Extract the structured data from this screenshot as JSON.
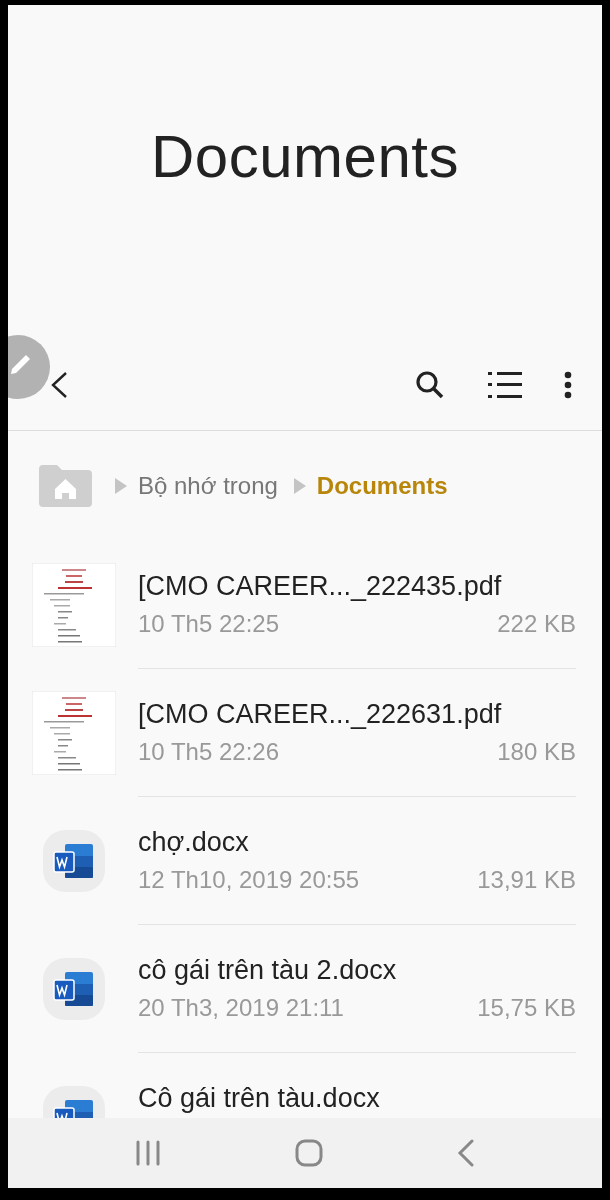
{
  "header": {
    "title": "Documents"
  },
  "breadcrumb": [
    {
      "label": "Bộ nhớ trong",
      "current": false
    },
    {
      "label": "Documents",
      "current": true
    }
  ],
  "files": [
    {
      "kind": "pdf",
      "name": "[CMO CAREER..._222435.pdf",
      "date": "10 Th5 22:25",
      "size": "222 KB"
    },
    {
      "kind": "pdf",
      "name": "[CMO CAREER..._222631.pdf",
      "date": "10 Th5 22:26",
      "size": "180 KB"
    },
    {
      "kind": "docx",
      "name": "chợ.docx",
      "date": "12 Th10, 2019 20:55",
      "size": "13,91 KB"
    },
    {
      "kind": "docx",
      "name": "cô gái trên tàu 2.docx",
      "date": "20 Th3, 2019 21:11",
      "size": "15,75 KB"
    },
    {
      "kind": "docx",
      "name": "Cô gái trên tàu.docx"
    }
  ]
}
